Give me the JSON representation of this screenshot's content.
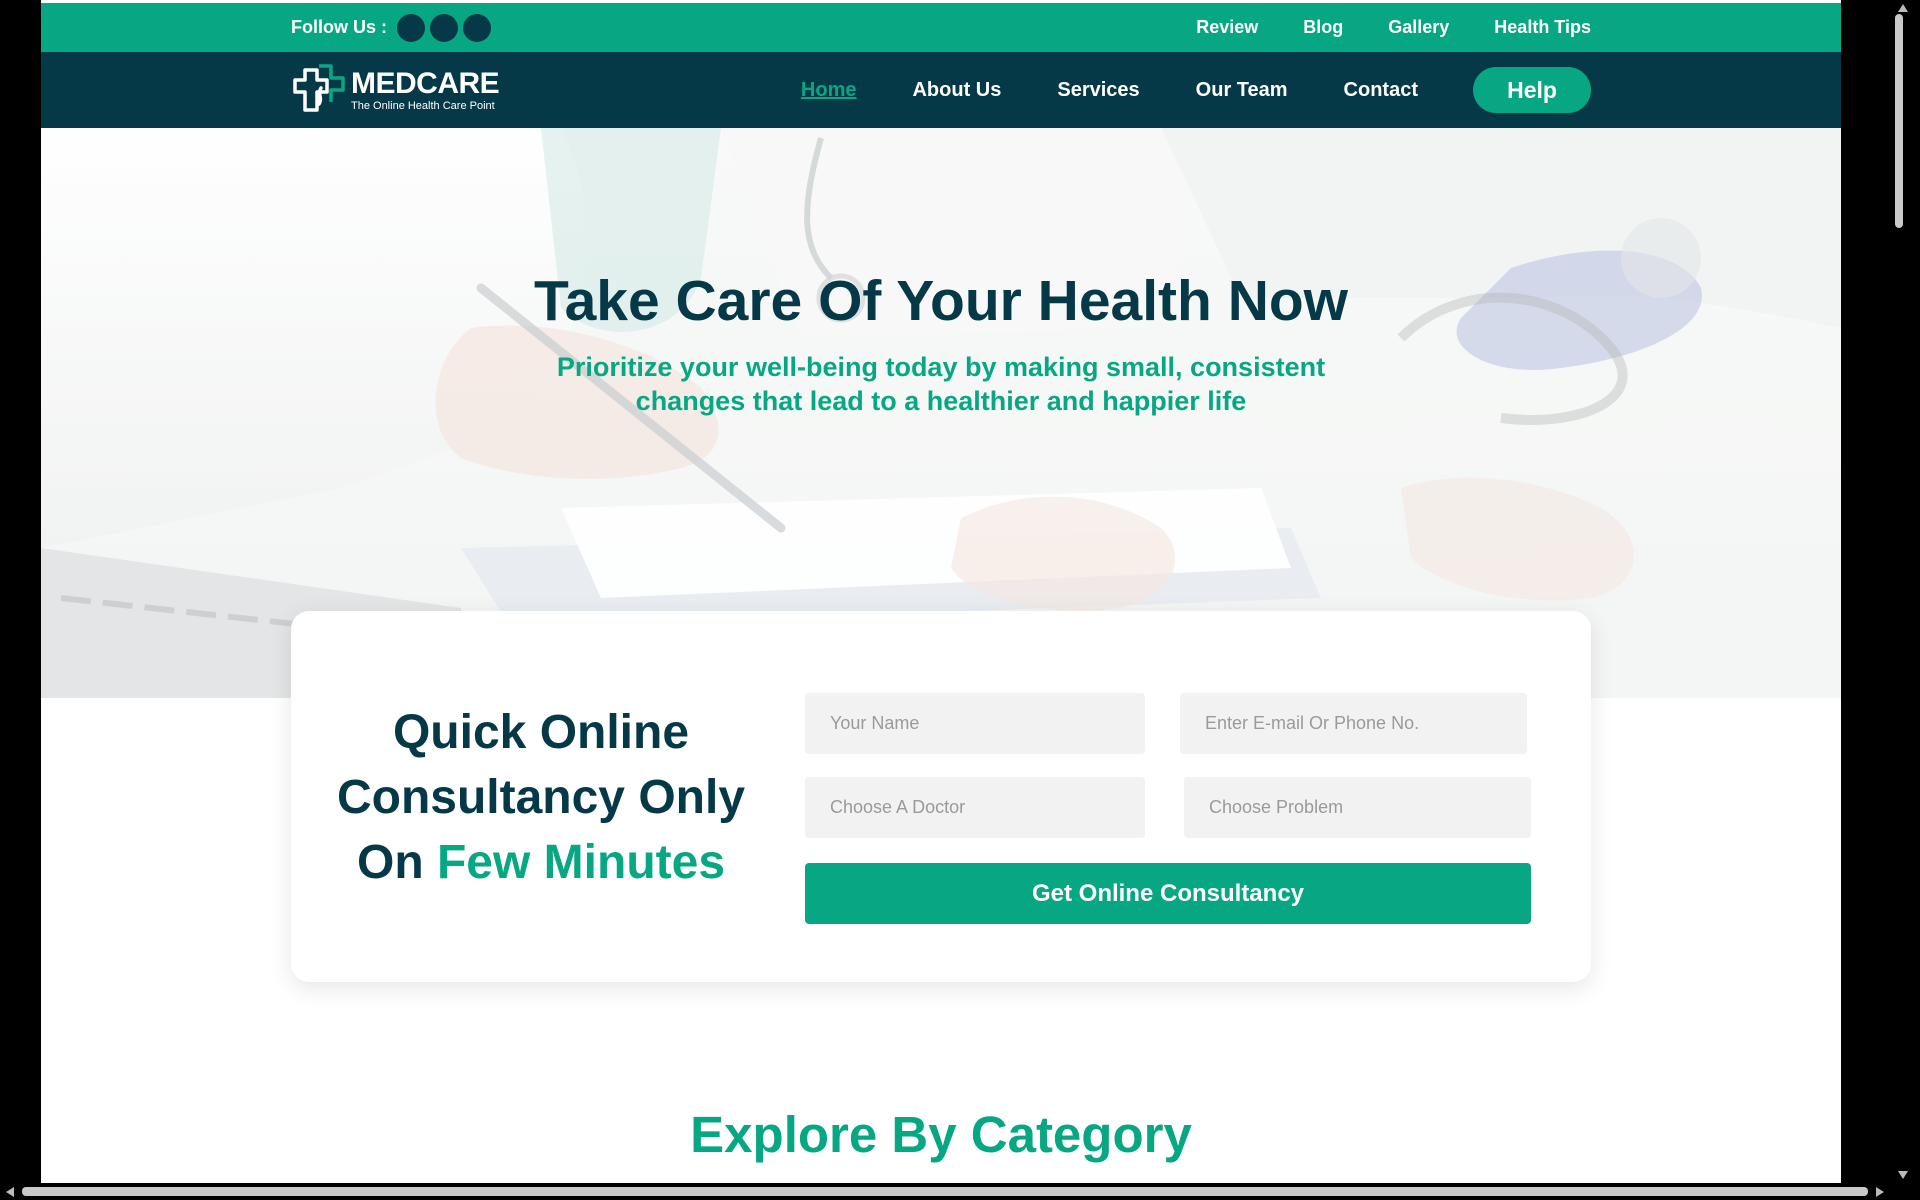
{
  "colors": {
    "brand_green": "#08a783",
    "navy": "#063948",
    "field_bg": "#f2f2f2"
  },
  "topbar": {
    "follow_label": "Follow Us :",
    "social_icons": [
      "social-icon-1",
      "social-icon-2",
      "social-icon-3"
    ],
    "links": [
      "Review",
      "Blog",
      "Gallery",
      "Health Tips"
    ]
  },
  "navbar": {
    "logo": {
      "name": "MEDCARE",
      "tagline": "The Online Health Care Point",
      "icon": "medical-cross-logo"
    },
    "items": [
      {
        "label": "Home",
        "active": true
      },
      {
        "label": "About Us",
        "active": false
      },
      {
        "label": "Services",
        "active": false
      },
      {
        "label": "Our Team",
        "active": false
      },
      {
        "label": "Contact",
        "active": false
      }
    ],
    "help_label": "Help"
  },
  "hero": {
    "title": "Take Care Of Your Health Now",
    "subtitle": "Prioritize your well-being today by making small, consistent changes that lead to a healthier and happier life"
  },
  "consultancy": {
    "title_part1": "Quick Online Consultancy Only On",
    "title_accent": "Few Minutes",
    "fields": {
      "name_placeholder": "Your Name",
      "contact_placeholder": "Enter E-mail Or Phone No.",
      "doctor_placeholder": "Choose A Doctor",
      "problem_placeholder": "Choose Problem"
    },
    "submit_label": "Get Online Consultancy"
  },
  "explore": {
    "title": "Explore By Category"
  }
}
